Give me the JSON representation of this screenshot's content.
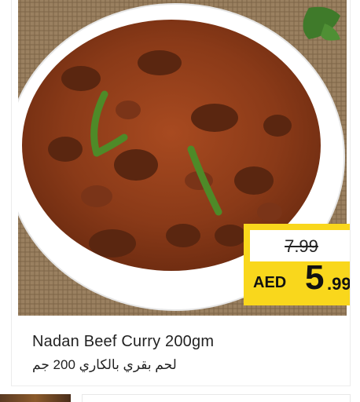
{
  "product": {
    "name_en": "Nadan Beef Curry 200gm",
    "name_ar": "لحم بقري بالكاري 200 جم",
    "image_alt": "beef curry in white bowl"
  },
  "price": {
    "old": "7.99",
    "currency": "AED",
    "new_int": "5",
    "new_dec": ".99"
  },
  "colors": {
    "tag_yellow": "#f9d71c",
    "curry": "#8a3d1c",
    "bowl": "#ffffff"
  }
}
